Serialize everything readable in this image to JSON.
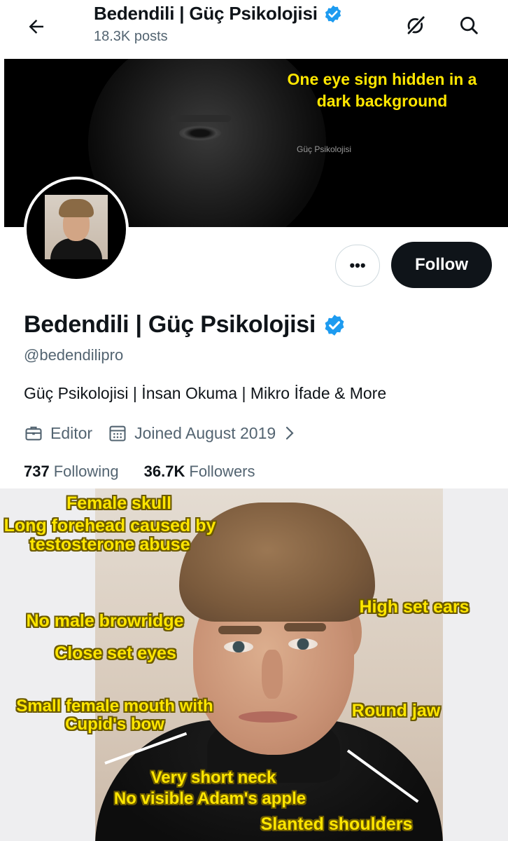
{
  "header": {
    "title": "Bedendili | Güç Psikolojisi",
    "posts_count": "18.3K posts",
    "back_icon": "arrow-left-icon",
    "grok_icon": "grok-icon",
    "search_icon": "search-icon"
  },
  "banner": {
    "caption": "One eye sign hidden in a dark background",
    "watermark": "Güç Psikolojisi"
  },
  "profile": {
    "name": "Bedendili | Güç Psikolojisi",
    "verified": true,
    "handle": "@bedendilipro",
    "bio": "Güç Psikolojisi | İnsan Okuma | Mikro İfade & More",
    "category": "Editor",
    "joined": "Joined August 2019",
    "following_count": "737",
    "following_label": "Following",
    "followers_count": "36.7K",
    "followers_label": "Followers",
    "more_label": "•••",
    "follow_label": "Follow"
  },
  "annotations": {
    "female_skull": "Female skull",
    "long_forehead": "Long forehead caused by testosterone abuse",
    "no_browridge": "No male browridge",
    "close_eyes": "Close set eyes",
    "small_mouth": "Small female mouth with Cupid's bow",
    "high_ears": "High set ears",
    "round_jaw": "Round jaw",
    "short_neck": "Very short neck",
    "no_adams_apple": "No visible Adam's apple",
    "slanted_shoulders": "Slanted shoulders"
  },
  "colors": {
    "verified_blue": "#1d9bf0",
    "annotation_yellow": "#ffe600",
    "text_secondary": "#536471",
    "follow_bg": "#0f1419"
  }
}
